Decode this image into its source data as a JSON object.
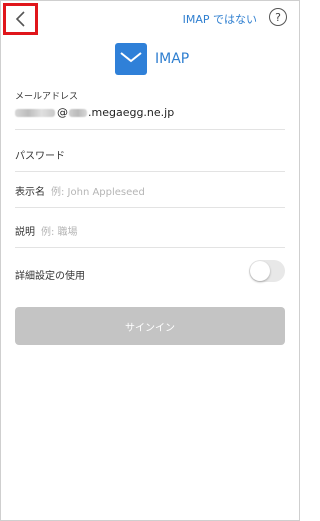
{
  "topbar": {
    "back_icon": "chevron-left-icon",
    "imap_toggle_label": "IMAP ではない",
    "help_label": "?"
  },
  "header": {
    "icon": "mail-envelope-icon",
    "title": "IMAP"
  },
  "form": {
    "email": {
      "label": "メールアドレス",
      "value_mid": "@",
      "value_domain": ".megaegg.ne.jp"
    },
    "password": {
      "label": "パスワード"
    },
    "display_name": {
      "label": "表示名",
      "placeholder": "例: John Appleseed"
    },
    "description": {
      "label": "説明",
      "placeholder": "例: 職場"
    },
    "advanced": {
      "label": "詳細設定の使用",
      "enabled": false
    },
    "signin_label": "サインイン"
  },
  "colors": {
    "accent": "#2f7fd0",
    "highlight_border": "#e0161b",
    "button_disabled": "#c4c4c4"
  }
}
